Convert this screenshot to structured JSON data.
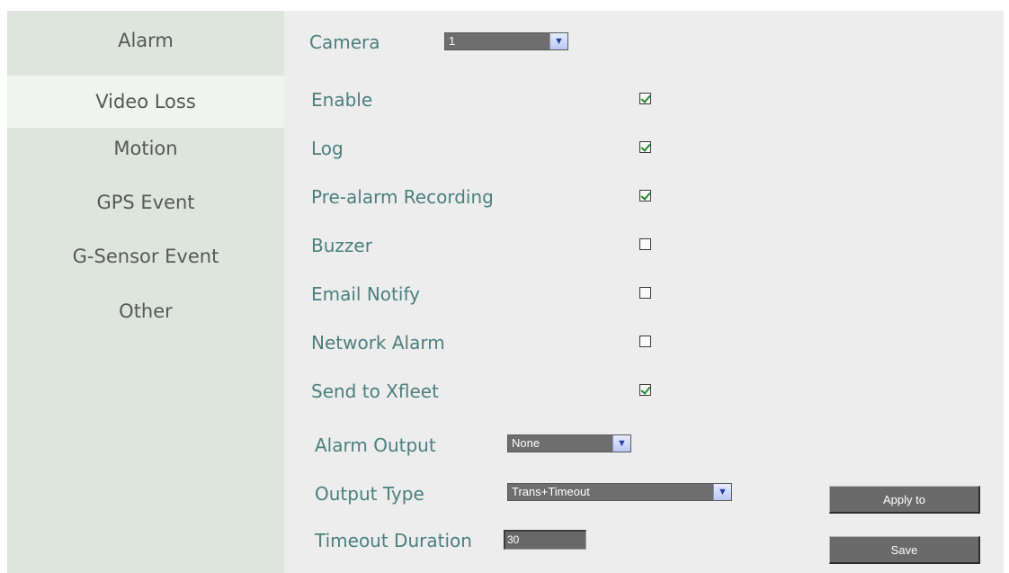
{
  "sidebar": {
    "items": [
      {
        "label": "Alarm"
      },
      {
        "label": "Video Loss",
        "active": true
      },
      {
        "label": "Motion"
      },
      {
        "label": "GPS Event"
      },
      {
        "label": "G-Sensor Event"
      },
      {
        "label": "Other"
      }
    ]
  },
  "camera": {
    "label": "Camera",
    "value": "1",
    "icon": "chevron-down-icon"
  },
  "options": [
    {
      "label": "Enable",
      "checked": true
    },
    {
      "label": "Log",
      "checked": true
    },
    {
      "label": "Pre-alarm Recording",
      "checked": true
    },
    {
      "label": "Buzzer",
      "checked": false
    },
    {
      "label": "Email Notify",
      "checked": false
    },
    {
      "label": "Network Alarm",
      "checked": false
    },
    {
      "label": "Send to Xfleet",
      "checked": true
    }
  ],
  "alarm_output": {
    "label": "Alarm Output",
    "value": "None"
  },
  "output_type": {
    "label": "Output Type",
    "value": "Trans+Timeout"
  },
  "timeout_duration": {
    "label": "Timeout Duration",
    "value": "30"
  },
  "buttons": {
    "apply_label": "Apply to",
    "save_label": "Save"
  },
  "colors": {
    "sidebar_bg": "#dde5dc",
    "sidebar_active": "#f1f3f1",
    "panel_bg": "#ededed",
    "label_text": "#4b7f7e",
    "control_bg": "#6e6e6e",
    "check_green": "#1d8a2a"
  }
}
